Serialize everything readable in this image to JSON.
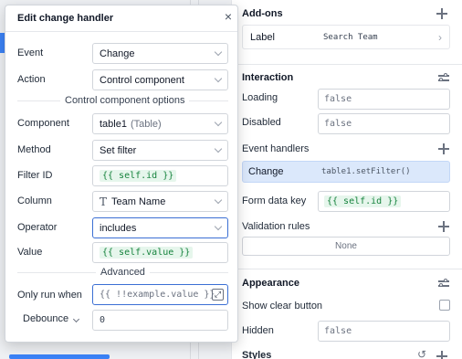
{
  "inspector": {
    "addons_title": "Add-ons",
    "addon_label": "Label",
    "addon_value": "Search Team",
    "interaction_title": "Interaction",
    "loading_label": "Loading",
    "loading_value": "false",
    "disabled_label": "Disabled",
    "disabled_value": "false",
    "event_handlers_label": "Event handlers",
    "handler_event": "Change",
    "handler_action": "table1.setFilter()",
    "form_data_key_label": "Form data key",
    "form_data_key_value": "{{ self.id }}",
    "validation_rules_label": "Validation rules",
    "validation_none": "None",
    "appearance_title": "Appearance",
    "show_clear_button_label": "Show clear button",
    "hidden_label": "Hidden",
    "hidden_value": "false",
    "styles_label": "Styles"
  },
  "modal": {
    "title": "Edit change handler",
    "close_glyph": "×",
    "event_label": "Event",
    "event_value": "Change",
    "action_label": "Action",
    "action_value": "Control component",
    "options_separator": "Control component options",
    "component_label": "Component",
    "component_value": "table1",
    "component_type": "(Table)",
    "method_label": "Method",
    "method_value": "Set filter",
    "filter_id_label": "Filter ID",
    "filter_id_value": "{{ self.id }}",
    "column_label": "Column",
    "column_value": "Team Name",
    "operator_label": "Operator",
    "operator_value": "includes",
    "value_label": "Value",
    "value_value": "{{ self.value }}",
    "advanced_separator": "Advanced",
    "only_run_when_label": "Only run when",
    "only_run_when_placeholder": "{{ !!example.value }}",
    "debounce_label": "Debounce",
    "debounce_value": "0"
  }
}
